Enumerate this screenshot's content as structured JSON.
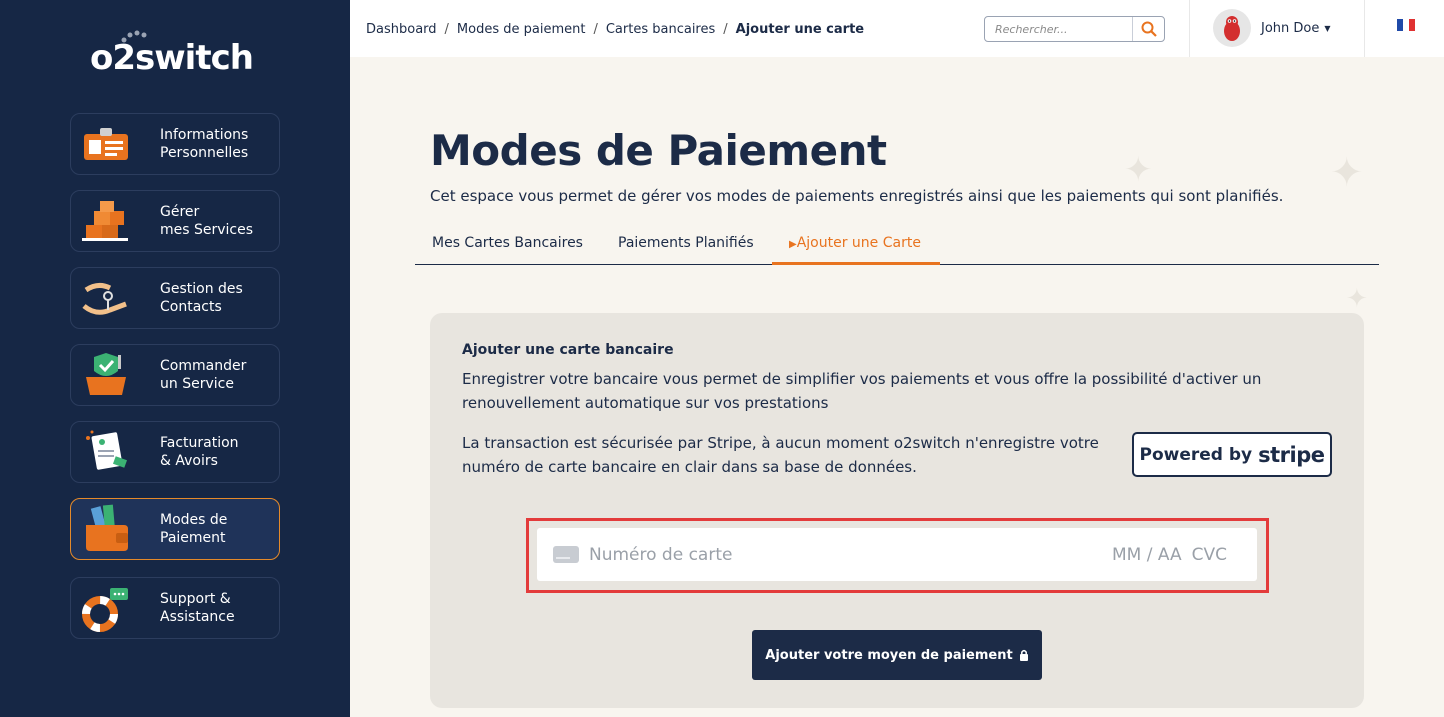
{
  "sidebar": {
    "logo": "o2switch",
    "items": [
      {
        "label": "Informations\nPersonnelles",
        "icon": "id-card-icon"
      },
      {
        "label": "Gérer\nmes Services",
        "icon": "boxes-icon"
      },
      {
        "label": "Gestion des\nContacts",
        "icon": "handshake-keys-icon"
      },
      {
        "label": "Commander\nun Service",
        "icon": "shopping-basket-icon"
      },
      {
        "label": "Facturation\n& Avoirs",
        "icon": "invoice-icon"
      },
      {
        "label": "Modes de\nPaiement",
        "icon": "wallet-icon"
      },
      {
        "label": "Support &\nAssistance",
        "icon": "lifebuoy-icon"
      }
    ]
  },
  "topbar": {
    "breadcrumb": [
      "Dashboard",
      "Modes de paiement",
      "Cartes bancaires",
      "Ajouter une carte"
    ],
    "separator": "/",
    "search_placeholder": "Rechercher...",
    "user_name": "John Doe"
  },
  "page": {
    "title": "Modes de Paiement",
    "subtitle": "Cet espace vous permet de gérer vos modes de paiements enregistrés ainsi que les paiements qui sont planifiés.",
    "tabs": [
      "Mes Cartes Bancaires",
      "Paiements Planifiés",
      "Ajouter une Carte"
    ]
  },
  "card": {
    "title": "Ajouter une carte bancaire",
    "description": "Enregistrer votre bancaire vous permet de simplifier vos paiements et vous offre la possibilité d'activer un renouvellement automatique sur vos prestations",
    "security": "La transaction est sécurisée par Stripe, à aucun moment o2switch n'enregistre votre numéro de carte bancaire en clair dans sa base de données.",
    "stripe_powered": "Powered by",
    "stripe_brand": "stripe",
    "card_number_placeholder": "Numéro de carte",
    "expiry_placeholder": "MM / AA",
    "cvc_placeholder": "CVC",
    "submit_label": "Ajouter votre moyen de paiement"
  },
  "colors": {
    "sidebar_bg": "#162745",
    "accent": "#e8731f",
    "navy": "#1c2b47",
    "highlight": "#e33b3b"
  }
}
